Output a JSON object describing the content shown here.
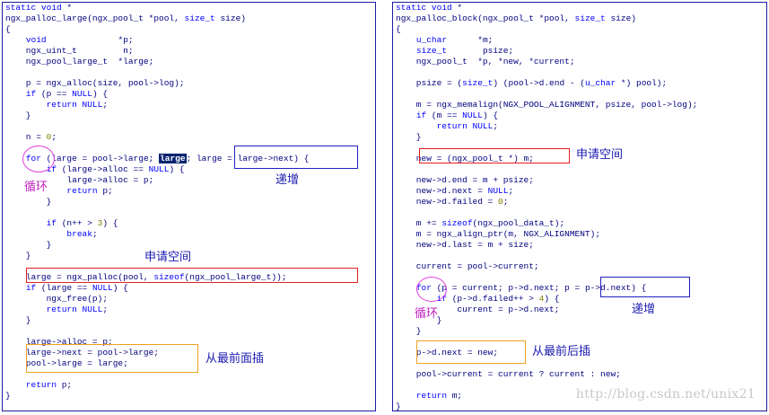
{
  "left": {
    "lines": [
      "static void *",
      "ngx_palloc_large(ngx_pool_t *pool, size_t size)",
      "{",
      "    void              *p;",
      "    ngx_uint_t         n;",
      "    ngx_pool_large_t  *large;",
      "",
      "    p = ngx_alloc(size, pool->log);",
      "    if (p == NULL) {",
      "        return NULL;",
      "    }",
      "",
      "    n = 0;",
      "",
      "    for (large = pool->large; large; large = large->next) {",
      "        if (large->alloc == NULL) {",
      "            large->alloc = p;",
      "            return p;",
      "        }",
      "",
      "        if (n++ > 3) {",
      "            break;",
      "        }",
      "    }",
      "",
      "    large = ngx_palloc(pool, sizeof(ngx_pool_large_t));",
      "    if (large == NULL) {",
      "        ngx_free(p);",
      "        return NULL;",
      "    }",
      "",
      "    large->alloc = p;",
      "    large->next = pool->large;",
      "    pool->large = large;",
      "",
      "    return p;",
      "}"
    ],
    "annotations": {
      "loop": "循环",
      "increment": "递增",
      "alloc_space": "申请空间",
      "insert_front": "从最前面插"
    }
  },
  "right": {
    "lines": [
      "static void *",
      "ngx_palloc_block(ngx_pool_t *pool, size_t size)",
      "{",
      "    u_char      *m;",
      "    size_t       psize;",
      "    ngx_pool_t  *p, *new, *current;",
      "",
      "    psize = (size_t) (pool->d.end - (u_char *) pool);",
      "",
      "    m = ngx_memalign(NGX_POOL_ALIGNMENT, psize, pool->log);",
      "    if (m == NULL) {",
      "        return NULL;",
      "    }",
      "",
      "    new = (ngx_pool_t *) m;",
      "",
      "    new->d.end = m + psize;",
      "    new->d.next = NULL;",
      "    new->d.failed = 0;",
      "",
      "    m += sizeof(ngx_pool_data_t);",
      "    m = ngx_align_ptr(m, NGX_ALIGNMENT);",
      "    new->d.last = m + size;",
      "",
      "    current = pool->current;",
      "",
      "    for (p = current; p->d.next; p = p->d.next) {",
      "        if (p->d.failed++ > 4) {",
      "            current = p->d.next;",
      "        }",
      "    }",
      "",
      "    p->d.next = new;",
      "",
      "    pool->current = current ? current : new;",
      "",
      "    return m;",
      "}"
    ],
    "annotations": {
      "alloc_space": "申请空间",
      "loop": "循环",
      "increment": "递增",
      "insert_back": "从最前后插"
    }
  },
  "watermark": "http://blog.csdn.net/unix21"
}
